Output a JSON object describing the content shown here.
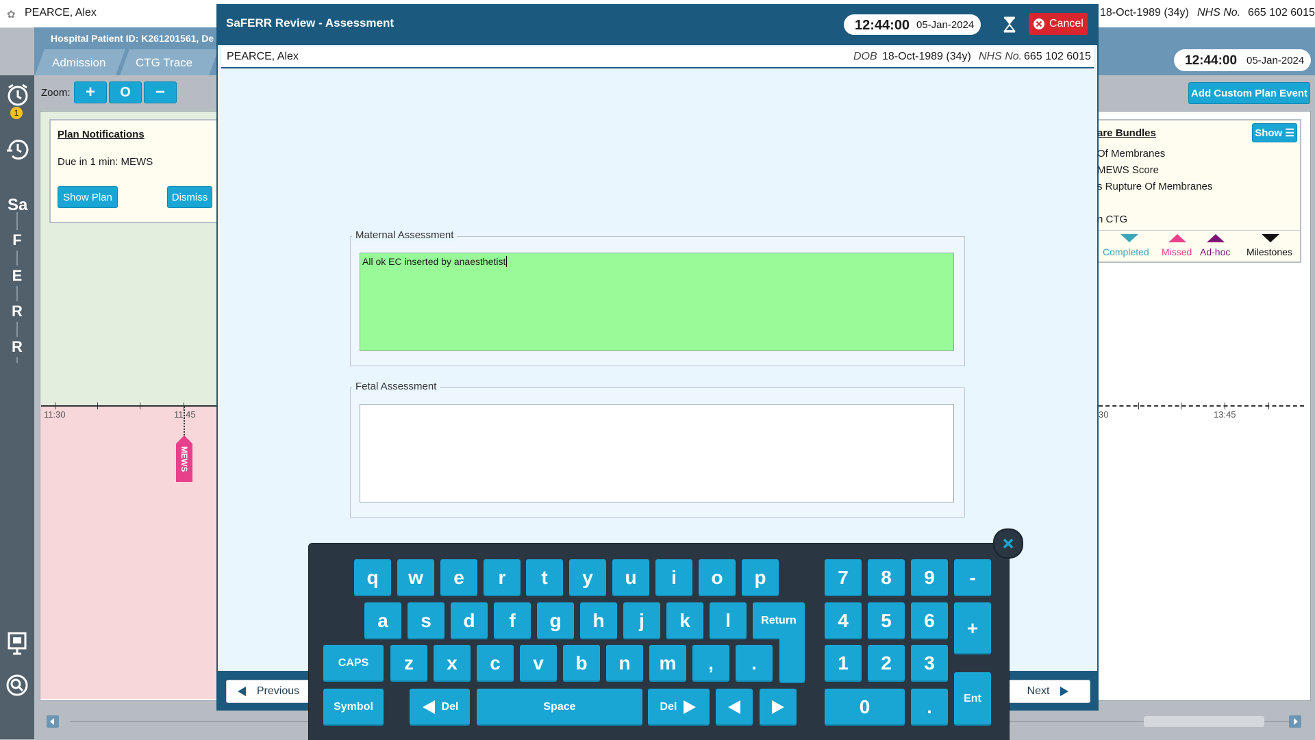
{
  "background": {
    "patient_name": "PEARCE, Alex",
    "top_dob": "18-Oct-1989 (34y)",
    "top_nhs_label": "NHS No.",
    "top_nhs_value": "665 102 6015",
    "hospital_id": "Hospital Patient ID: K261201561, De",
    "tabs": [
      "Admission",
      "CTG Trace"
    ],
    "clock_time": "12:44:00",
    "clock_date": "05-Jan-2024",
    "zoom_label": "Zoom:",
    "zoom_buttons": [
      "+",
      "O",
      "−"
    ],
    "add_custom_event": "Add Custom Plan Event",
    "rail_badge": "1",
    "rail_letters": [
      "Sa",
      "F",
      "E",
      "R",
      "R"
    ],
    "plan_notifications": {
      "title": "Plan Notifications",
      "due_text": "Due in 1 min: MEWS",
      "show_plan": "Show Plan",
      "dismiss": "Dismiss"
    },
    "care_bundles": {
      "title": "are Bundles",
      "show_button": "Show ☰",
      "items": [
        "Of Membranes",
        "MEWS Score",
        "s Rupture Of Membranes",
        "",
        "n CTG"
      ],
      "legend": [
        "Completed",
        "Missed",
        "Ad-hoc",
        "Milestones"
      ]
    },
    "left_ticks": [
      "11:30",
      "11:45"
    ],
    "right_ticks": [
      "30",
      "13:45"
    ],
    "mews_tag": "MEWS"
  },
  "colors": {
    "modal_header": "#1b5a7e",
    "key_blue": "#1aa6d5",
    "maternal_bg": "#98fb98",
    "cancel_red": "#d9252e",
    "completed": "#3aa7b8",
    "missed": "#e8408a",
    "adhoc": "#7d1277",
    "milestones": "#111111"
  },
  "modal": {
    "title": "SaFERR Review - Assessment",
    "time": "12:44:00",
    "date": "05-Jan-2024",
    "cancel": "Cancel",
    "patient_name": "PEARCE, Alex",
    "dob_label": "DOB",
    "dob_value": "18-Oct-1989 (34y)",
    "nhs_label": "NHS No.",
    "nhs_value": "665 102 6015",
    "maternal_label": "Maternal Assessment",
    "maternal_value": "All ok EC inserted by anaesthetist",
    "fetal_label": "Fetal Assessment",
    "fetal_value": "",
    "previous": "Previous",
    "next": "Next"
  },
  "keyboard": {
    "row1": [
      "q",
      "w",
      "e",
      "r",
      "t",
      "y",
      "u",
      "i",
      "o",
      "p"
    ],
    "row2": [
      "a",
      "s",
      "d",
      "f",
      "g",
      "h",
      "j",
      "k",
      "l"
    ],
    "row3": [
      "z",
      "x",
      "c",
      "v",
      "b",
      "n",
      "m",
      ",",
      "."
    ],
    "return": "Return",
    "caps": "CAPS",
    "symbol": "Symbol",
    "del_left": "Del",
    "space": "Space",
    "del_right": "Del",
    "num_row1": [
      "7",
      "8",
      "9",
      "-"
    ],
    "num_row2": [
      "4",
      "5",
      "6"
    ],
    "num_row3": [
      "1",
      "2",
      "3"
    ],
    "plus": "+",
    "zero": "0",
    "dot": ".",
    "ent": "Ent"
  }
}
